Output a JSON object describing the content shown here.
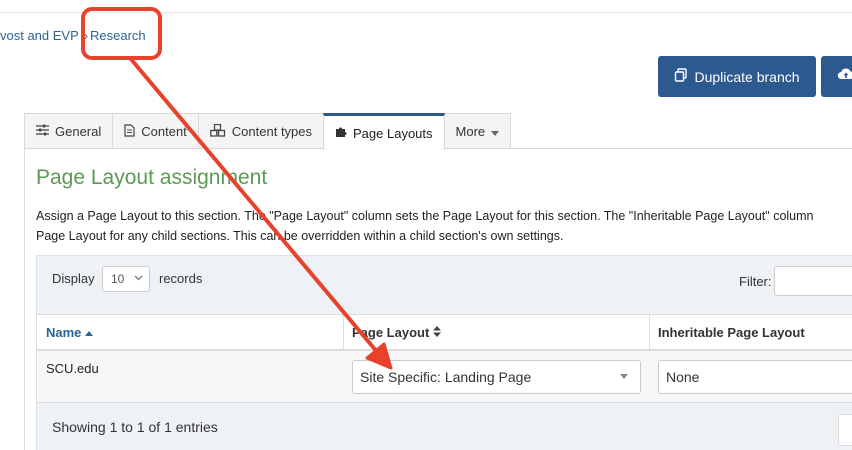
{
  "breadcrumb": {
    "parent": "vost and EVP",
    "separator": "»",
    "current": "Research"
  },
  "toolbar": {
    "duplicate_label": "Duplicate branch",
    "duplicate_icon": "copy-icon",
    "upload_icon": "cloud-upload-icon",
    "button_color": "#2d5a8e"
  },
  "tabs": [
    {
      "label": "General",
      "icon": "sliders-icon",
      "active": false
    },
    {
      "label": "Content",
      "icon": "document-icon",
      "active": false
    },
    {
      "label": "Content types",
      "icon": "cubes-icon",
      "active": false
    },
    {
      "label": "Page Layouts",
      "icon": "puzzle-icon",
      "active": true
    },
    {
      "label": "More",
      "icon": "caret-down-icon",
      "active": false
    }
  ],
  "section": {
    "title": "Page Layout assignment",
    "title_color": "#5b9a55",
    "description_line1": "Assign a Page Layout to this section. The \"Page Layout\" column sets the Page Layout for this section. The \"Inheritable Page Layout\" column",
    "description_line2": "Page Layout for any child sections. This can be overridden within a child section's own settings."
  },
  "table_controls": {
    "display_label": "Display",
    "display_value": "10",
    "records_label": "records",
    "filter_label": "Filter:",
    "filter_value": ""
  },
  "table": {
    "headers": {
      "name": "Name",
      "layout": "Page Layout",
      "inherit": "Inheritable Page Layout"
    },
    "rows": [
      {
        "name": "SCU.edu",
        "layout": "Site Specific: Landing Page",
        "inherit": "None"
      }
    ],
    "info": "Showing 1 to 1 of 1 entries"
  },
  "annotation": {
    "color": "#e8412c",
    "type": "callout-box-and-arrow"
  }
}
